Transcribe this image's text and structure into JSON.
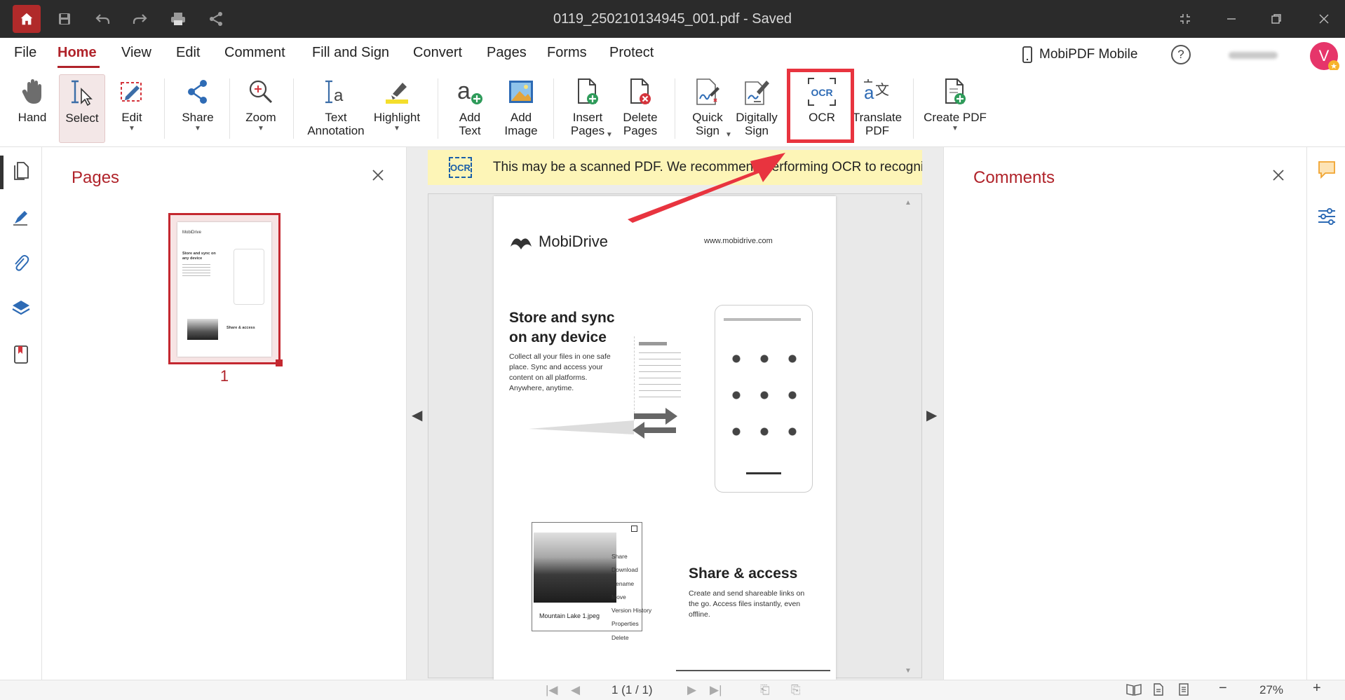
{
  "titlebar": {
    "title": "0119_250210134945_001.pdf - Saved"
  },
  "menu": {
    "tabs": [
      "File",
      "Home",
      "View",
      "Edit",
      "Comment",
      "Fill and Sign",
      "Convert",
      "Pages",
      "Forms",
      "Protect"
    ],
    "active": "Home",
    "mobile_label": "MobiPDF Mobile",
    "help_label": "?",
    "avatar_initial": "V"
  },
  "ribbon": {
    "hand": "Hand",
    "select": "Select",
    "edit": "Edit",
    "share": "Share",
    "zoom": "Zoom",
    "text_annotation_1": "Text",
    "text_annotation_2": "Annotation",
    "highlight": "Highlight",
    "add_text_1": "Add",
    "add_text_2": "Text",
    "add_image_1": "Add",
    "add_image_2": "Image",
    "insert_pages_1": "Insert",
    "insert_pages_2": "Pages",
    "delete_pages_1": "Delete",
    "delete_pages_2": "Pages",
    "quick_sign_1": "Quick",
    "quick_sign_2": "Sign",
    "digitally_sign_1": "Digitally",
    "digitally_sign_2": "Sign",
    "ocr": "OCR",
    "ocr_icon_text": "OCR",
    "translate_1": "Translate",
    "translate_2": "PDF",
    "create_pdf": "Create PDF"
  },
  "pages_panel": {
    "title": "Pages",
    "page_number": "1"
  },
  "banner": {
    "icon_text": "OCR",
    "text": "This may be a scanned PDF. We recommend performing OCR to recognize th"
  },
  "document": {
    "brand": "MobiDrive",
    "url": "www.mobidrive.com",
    "heading1_line1": "Store and sync",
    "heading1_line2": "on any device",
    "paragraph1": "Collect all your files in one safe place. Sync and access your content on all platforms. Anywhere, anytime.",
    "heading2": "Share & access",
    "paragraph2": "Create and send shareable links on the go. Access files instantly, even offline.",
    "menu_items": [
      "Share",
      "Download",
      "Rename",
      "Move",
      "Version History",
      "Properties",
      "Delete"
    ],
    "file_label": "Mountain Lake 1.jpeg",
    "thumb_brand": "MobiDrive",
    "thumb_h1": "Store and sync on any device",
    "thumb_h2": "Share & access"
  },
  "comments_panel": {
    "title": "Comments"
  },
  "statusbar": {
    "page_indicator": "1 (1 / 1)",
    "zoom": "27%",
    "zoom_out": "−",
    "zoom_in": "+"
  },
  "colors": {
    "brand_red": "#b0232a",
    "highlight_red": "#e8343f",
    "banner_yellow": "#fdf5b7",
    "titlebar": "#2b2b2b"
  }
}
